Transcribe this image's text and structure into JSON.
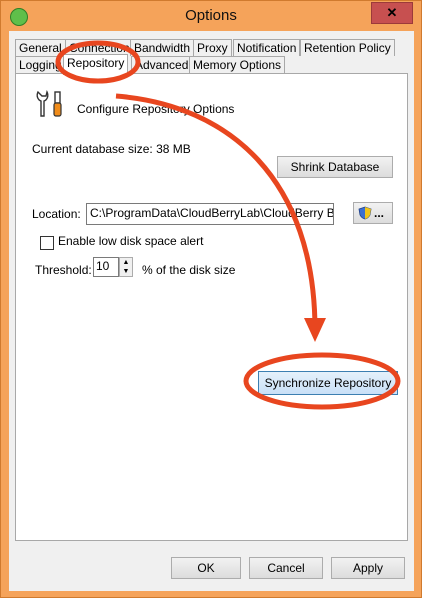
{
  "window": {
    "title": "Options",
    "close_label": "✕"
  },
  "tabs": [
    "General",
    "Connection",
    "Bandwidth",
    "Proxy",
    "Notification",
    "Retention Policy",
    "Logging",
    "Repository",
    "Advanced",
    "Memory Options"
  ],
  "repository": {
    "header": "Configure Repository Options",
    "db_size_label": "Current database size: 38 MB",
    "shrink_button": "Shrink Database",
    "location_label": "Location:",
    "location_value": "C:\\ProgramData\\CloudBerryLab\\CloudBerry Backup",
    "browse_button": "...",
    "low_disk_label": "Enable low disk space alert",
    "low_disk_checked": false,
    "threshold_label": "Threshold:",
    "threshold_value": "10",
    "threshold_suffix": "% of the disk size",
    "sync_button": "Synchronize Repository"
  },
  "footer": {
    "ok": "OK",
    "cancel": "Cancel",
    "apply": "Apply"
  },
  "colors": {
    "frame": "#f5a35a",
    "annotation": "#e8461f",
    "primary_button": "#c9e0f7"
  }
}
